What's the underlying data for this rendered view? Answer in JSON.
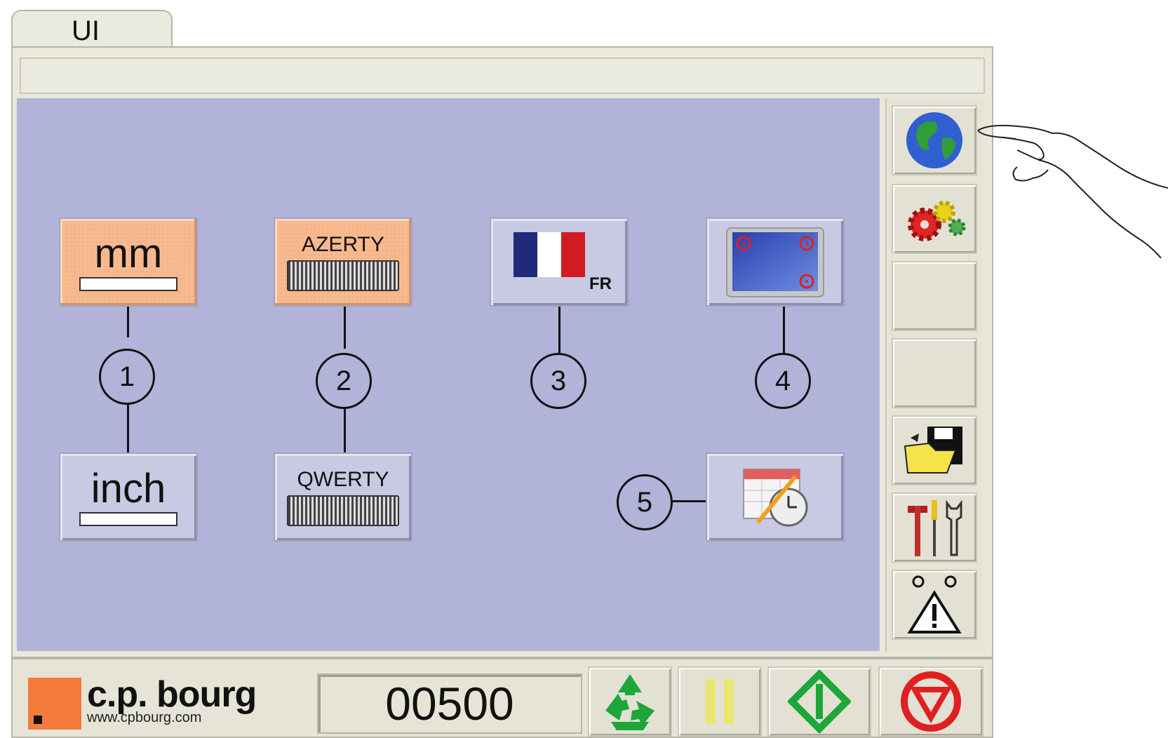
{
  "tab": {
    "label": "UI"
  },
  "options": {
    "unit_mm": "mm",
    "unit_inch": "inch",
    "kb_azerty": "AZERTY",
    "kb_qwerty": "QWERTY",
    "lang_code": "FR"
  },
  "callouts": [
    "1",
    "2",
    "3",
    "4",
    "5"
  ],
  "brand": {
    "name": "c.p. bourg",
    "url": "www.cpbourg.com"
  },
  "counter": "00500",
  "colors": {
    "content_bg": "#b2b3d9",
    "selected_option": "#f7b98f",
    "brand_orange": "#f47b3a",
    "start_green": "#1fa63a",
    "stop_red": "#e02020",
    "pause_yellow": "#e8e870"
  },
  "icons": {
    "side_panel": [
      "globe-icon",
      "gears-icon",
      "blank",
      "blank",
      "save-folder-icon",
      "tools-icon",
      "warning-icon"
    ],
    "controls": [
      "recycle-icon",
      "pause-icon",
      "start-icon",
      "stop-icon"
    ]
  },
  "selected": {
    "unit": "mm",
    "keyboard": "AZERTY"
  }
}
